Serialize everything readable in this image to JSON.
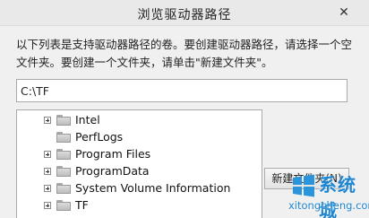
{
  "window": {
    "title": "浏览驱动器路径",
    "close_label": "✕"
  },
  "description": "以下列表是支持驱动器路径的卷。要创建驱动器路径，请选择一个空文件夹。要创建一个文件夹，请单击\"新建文件夹\"。",
  "path_field": {
    "value": "C:\\TF"
  },
  "folders": [
    {
      "label": "Intel",
      "expandable": true
    },
    {
      "label": "PerfLogs",
      "expandable": false
    },
    {
      "label": "Program Files",
      "expandable": true
    },
    {
      "label": "ProgramData",
      "expandable": true
    },
    {
      "label": "System Volume Information",
      "expandable": true
    },
    {
      "label": "TF",
      "expandable": true
    }
  ],
  "buttons": {
    "new_folder": "新建文件夹(N)"
  },
  "watermark": {
    "logo_text": "系统城",
    "url": "xitongcheng.com"
  },
  "colors": {
    "watermark": "#1e86d0"
  }
}
